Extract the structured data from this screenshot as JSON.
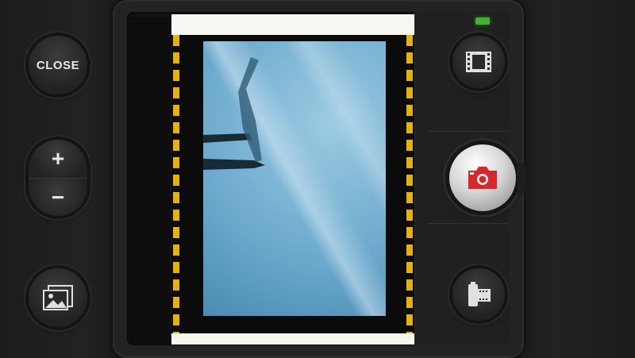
{
  "controls": {
    "close_label": "CLOSE",
    "zoom_in_label": "+",
    "zoom_out_label": "−"
  },
  "icons": {
    "gallery": "image-gallery-icon",
    "film": "film-strip-icon",
    "shutter": "camera-icon",
    "film_roll": "film-roll-icon"
  },
  "colors": {
    "shutter_icon": "#d9262b",
    "status_led": "#3fb22f",
    "film_edge": "#e6b400",
    "photo_tint": "#6aa8cc"
  }
}
